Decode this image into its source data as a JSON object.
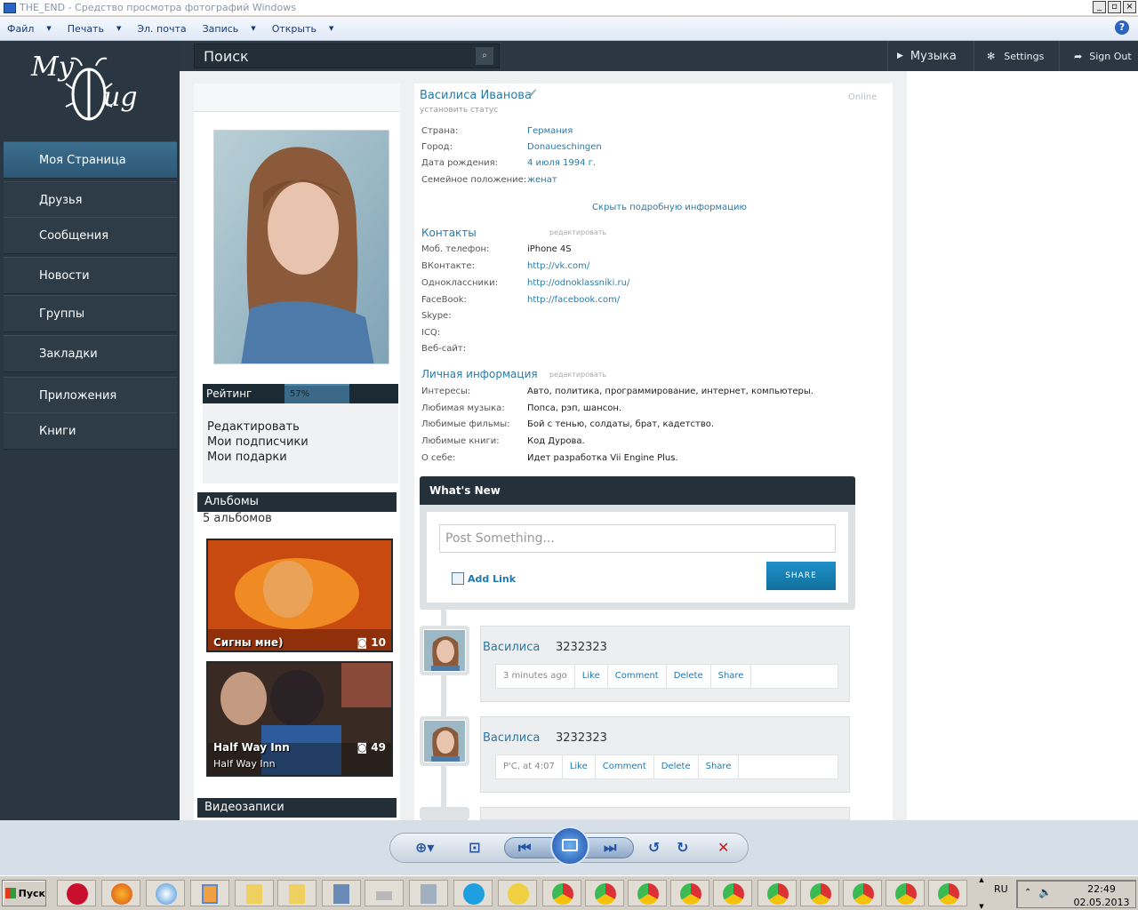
{
  "window": {
    "title": "THE_END - Средство просмотра фотографий Windows"
  },
  "menu": {
    "items": [
      "Файл",
      "Печать",
      "Эл. почта",
      "Запись",
      "Открыть"
    ]
  },
  "site": {
    "logo": {
      "top": "My",
      "bottom": "ug"
    },
    "search": {
      "label": "Поиск"
    },
    "topnav": {
      "music": "Музыка",
      "settings": "Settings",
      "signout": "Sign Out"
    },
    "nav": [
      "Моя Страница",
      "Друзья",
      "Сообщения",
      "Новости",
      "Группы",
      "Закладки",
      "Приложения",
      "Книги"
    ],
    "rating": {
      "label": "Рейтинг",
      "value": "57%",
      "percent": 57
    },
    "profile_links": [
      "Редактировать",
      "Мои подписчики",
      "Мои подарки"
    ],
    "albums": {
      "heading": "Альбомы",
      "count": "5 альбомов",
      "items": [
        {
          "caption": "Сигны мне)",
          "count": "10",
          "sub": ""
        },
        {
          "caption": "Half Way Inn",
          "count": "49",
          "sub": "Half Way Inn"
        }
      ]
    },
    "videos": {
      "heading": "Видеозаписи"
    },
    "profile": {
      "name": "Василиса Иванова",
      "status": "установить статус",
      "online": "Online",
      "info": [
        {
          "label": "Страна:",
          "value": "Германия"
        },
        {
          "label": "Город:",
          "value": "Donaueschingen"
        },
        {
          "label": "Дата рождения:",
          "value": "4 июля 1994 г."
        },
        {
          "label": "Семейное положение:",
          "value": "женат"
        }
      ],
      "hide_info": "Скрыть подробную информацию",
      "contacts": {
        "heading": "Контакты",
        "edit": "редактировать",
        "rows": [
          {
            "label": "Моб. телефон:",
            "value": "iPhone 4S"
          },
          {
            "label": "ВКонтакте:",
            "value": "http://vk.com/"
          },
          {
            "label": "Одноклассники:",
            "value": "http://odnoklassniki.ru/"
          },
          {
            "label": "FaceBook:",
            "value": "http://facebook.com/"
          },
          {
            "label": "Skype:",
            "value": ""
          },
          {
            "label": "ICQ:",
            "value": ""
          },
          {
            "label": "Веб-сайт:",
            "value": ""
          }
        ]
      },
      "personal": {
        "heading": "Личная информация",
        "edit": "редактировать",
        "rows": [
          {
            "label": "Интересы:",
            "value": "Авто, политика, программирование, интернет, компьютеры."
          },
          {
            "label": "Любимая музыка:",
            "value": "Попса, рэп, шансон."
          },
          {
            "label": "Любимые фильмы:",
            "value": "Бой с тенью, солдаты, брат, кадетство."
          },
          {
            "label": "Любимые книги:",
            "value": "Код Дурова."
          },
          {
            "label": "О себе:",
            "value": "Идет разработка Vii Engine Plus."
          }
        ]
      }
    },
    "whats_new": {
      "heading": "What's New",
      "placeholder": "Post Something...",
      "add_link": "Add Link",
      "share": "SHARE"
    },
    "posts": [
      {
        "name": "Василиса",
        "text": "3232323",
        "time": "3 minutes ago",
        "actions": [
          "Like",
          "Comment",
          "Delete",
          "Share"
        ]
      },
      {
        "name": "Василиса",
        "text": "3232323",
        "time": "Р'С, at 4:07",
        "actions": [
          "Like",
          "Comment",
          "Delete",
          "Share"
        ]
      }
    ]
  },
  "taskbar": {
    "start": "Пуск",
    "lang": "RU",
    "time": "22:49",
    "date": "02.05.2013"
  },
  "colors": {
    "accent": "#2a7aa6",
    "sidebar": "#2a3742",
    "share": "#1e8fc8"
  }
}
